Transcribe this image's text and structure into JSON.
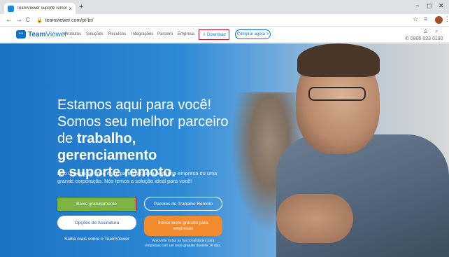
{
  "browser": {
    "tab_title": "TeamViewer suporte remoto, ac",
    "tab_close": "×",
    "new_tab": "+",
    "url": "teamviewer.com/pt-br/",
    "back": "←",
    "forward": "→",
    "reload": "C",
    "lock": "🔒",
    "star": "☆",
    "reading_list": "≡",
    "minimize": "−",
    "restore": "◻",
    "close_window": "✕",
    "menu": "⋮"
  },
  "header": {
    "logo_team": "Team",
    "logo_viewer": "Viewer",
    "nav": [
      "Produtos",
      "Soluções",
      "Recursos",
      "Integrações",
      "Parceiro",
      "Empresa"
    ],
    "download": "⇩ Download",
    "buy": "Comprar agora >",
    "phone": "✆ 0800 023 0190",
    "user_icon": "♙",
    "search_icon": "⌕"
  },
  "hero": {
    "title_line1": "Estamos aqui para você!",
    "title_line2": "Somos seu melhor parceiro",
    "title_line3_plain": "de ",
    "title_line3_bold": "trabalho, gerenciamento",
    "title_line4_bold": "e suporte remoto.",
    "subtitle": "Não importa se você é um particular, uma pequena empresa ou uma grande corporação. Nós temos a solução ideal para você!",
    "btn_baixe": "Baixe gratuitamente",
    "btn_pacotes": "Pacotes de Trabalho Remoto",
    "btn_opcoes": "Opções de Assinatura",
    "btn_teste": "Iniciar teste gratuito para empresas",
    "saiba_mais": "Saiba mais sobre o TeamViewer",
    "aproveite": "Aproveite todas as funcionalidades para empresas com um teste gratuito durante 14 dias."
  },
  "colors": {
    "brand_blue": "#0e73cc",
    "cta_green": "#7cb342",
    "cta_orange": "#f28a2e",
    "highlight_red": "#c8102e"
  }
}
